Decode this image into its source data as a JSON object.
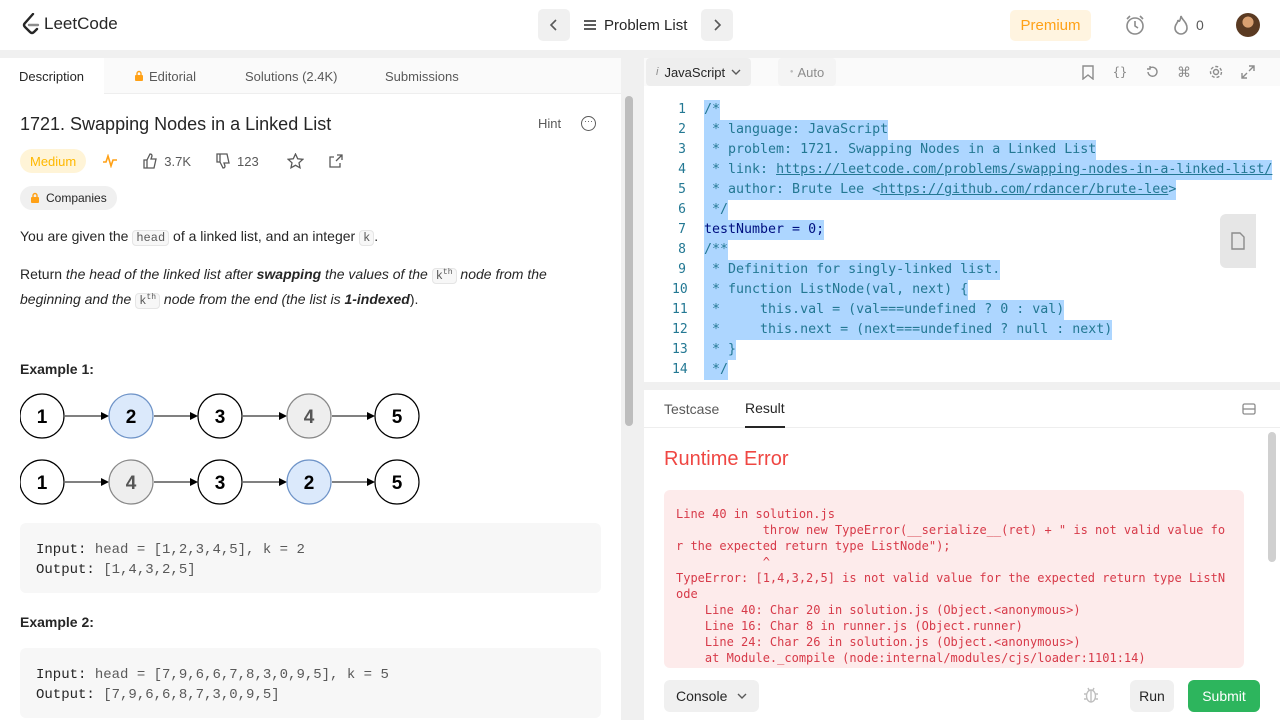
{
  "app": {
    "name": "LeetCode"
  },
  "header": {
    "problem_list_label": "Problem List",
    "premium_label": "Premium",
    "streak_count": "0"
  },
  "left_tabs": {
    "description": "Description",
    "editorial": "Editorial",
    "solutions": "Solutions (2.4K)",
    "submissions": "Submissions"
  },
  "problem": {
    "title": "1721. Swapping Nodes in a Linked List",
    "hint_label": "Hint",
    "difficulty": "Medium",
    "likes": "3.7K",
    "dislikes": "123",
    "companies_label": "Companies",
    "desc1": {
      "a": "You are given the ",
      "code1": "head",
      "b": " of a linked list, and an integer ",
      "code2": "k",
      "c": "."
    },
    "desc2": {
      "a": "Return ",
      "b": "the head of the linked list after ",
      "c": "swapping",
      "d": " the values of the ",
      "kth1": "k",
      "sup1": "th",
      "e": " node from the beginning and the ",
      "kth2": "k",
      "sup2": "th",
      "f": " node from the end (the list is ",
      "g": "1-indexed",
      "h": ")."
    },
    "examples": [
      {
        "title": "Example 1:",
        "input_label": "Input:",
        "input": " head = [1,2,3,4,5], k = 2",
        "output_label": "Output:",
        "output": " [1,4,3,2,5]"
      },
      {
        "title": "Example 2:",
        "input_label": "Input:",
        "input": " head = [7,9,6,6,7,8,3,0,9,5], k = 5",
        "output_label": "Output:",
        "output": " [7,9,6,6,8,7,3,0,9,5]"
      }
    ],
    "diagram": {
      "row1": [
        "1",
        "2",
        "3",
        "4",
        "5"
      ],
      "row2": [
        "1",
        "4",
        "3",
        "2",
        "5"
      ]
    }
  },
  "editor": {
    "language": "JavaScript",
    "auto_label": "Auto",
    "lines": [
      {
        "n": "1",
        "t": "/*"
      },
      {
        "n": "2",
        "t": " * language: JavaScript"
      },
      {
        "n": "3",
        "t": " * problem: 1721. Swapping Nodes in a Linked List"
      },
      {
        "n": "4",
        "t": " * link: https://leetcode.com/problems/swapping-nodes-in-a-linked-list/"
      },
      {
        "n": "5",
        "t": " * author: Brute Lee <https://github.com/rdancer/brute-lee>"
      },
      {
        "n": "6",
        "t": " */"
      },
      {
        "n": "7",
        "t": "testNumber = 0;"
      },
      {
        "n": "8",
        "t": "/**"
      },
      {
        "n": "9",
        "t": " * Definition for singly-linked list."
      },
      {
        "n": "10",
        "t": " * function ListNode(val, next) {"
      },
      {
        "n": "11",
        "t": " *     this.val = (val===undefined ? 0 : val)"
      },
      {
        "n": "12",
        "t": " *     this.next = (next===undefined ? null : next)"
      },
      {
        "n": "13",
        "t": " * }"
      },
      {
        "n": "14",
        "t": " */"
      }
    ]
  },
  "results": {
    "tab_testcase": "Testcase",
    "tab_result": "Result",
    "status": "Runtime Error",
    "error_lines": [
      "Line 40 in solution.js",
      "            throw new TypeError(__serialize__(ret) + \" is not valid value for the expected return type ListNode\");",
      "            ^",
      "TypeError: [1,4,3,2,5] is not valid value for the expected return type ListNode",
      "    Line 40: Char 20 in solution.js (Object.<anonymous>)",
      "    Line 16: Char 8 in runner.js (Object.runner)",
      "    Line 24: Char 26 in solution.js (Object.<anonymous>)",
      "    at Module._compile (node:internal/modules/cjs/loader:1101:14)"
    ]
  },
  "bottom": {
    "console_label": "Console",
    "run_label": "Run",
    "submit_label": "Submit"
  },
  "colors": {
    "accent": "#ffa116",
    "error": "#ef4743",
    "submit": "#2db55d",
    "selection": "#add6ff",
    "highlight_node": "#dbe9fb"
  }
}
